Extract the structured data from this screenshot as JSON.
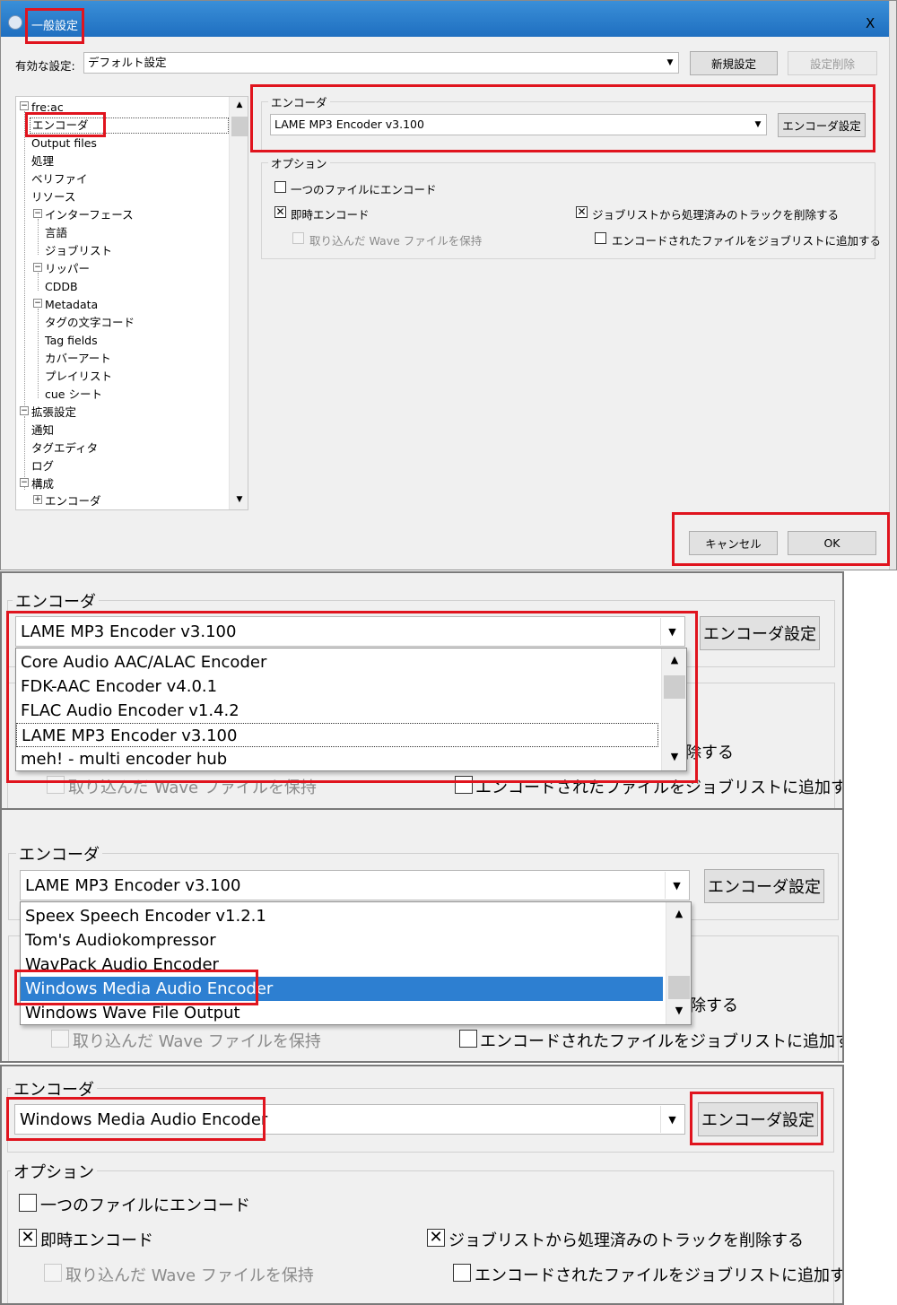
{
  "dialog": {
    "title": "一般設定",
    "close_label": "X",
    "active_setting_label": "有効な設定:",
    "active_setting_value": "デフォルト設定",
    "new_setting_button": "新規設定",
    "delete_setting_button": "設定削除",
    "cancel_button": "キャンセル",
    "ok_button": "OK"
  },
  "tree": {
    "items": [
      {
        "label": "fre:ac",
        "toggle": "−"
      },
      {
        "label": "エンコーダ"
      },
      {
        "label": "Output files"
      },
      {
        "label": "処理"
      },
      {
        "label": "ベリファイ"
      },
      {
        "label": "リソース"
      },
      {
        "label": "インターフェース",
        "toggle": "−"
      },
      {
        "label": "言語"
      },
      {
        "label": "ジョブリスト"
      },
      {
        "label": "リッパー",
        "toggle": "−"
      },
      {
        "label": "CDDB"
      },
      {
        "label": "Metadata",
        "toggle": "−"
      },
      {
        "label": "タグの文字コード"
      },
      {
        "label": "Tag fields"
      },
      {
        "label": "カバーアート"
      },
      {
        "label": "プレイリスト"
      },
      {
        "label": "cue シート"
      },
      {
        "label": "拡張設定",
        "toggle": "−"
      },
      {
        "label": "通知"
      },
      {
        "label": "タグエディタ"
      },
      {
        "label": "ログ"
      },
      {
        "label": "構成",
        "toggle": "−"
      },
      {
        "label": "エンコーダ",
        "toggle": "+"
      }
    ]
  },
  "encoder": {
    "group_label": "エンコーダ",
    "selected": "LAME MP3 Encoder v3.100",
    "settings_button": "エンコーダ設定"
  },
  "options": {
    "group_label": "オプション",
    "single_file": {
      "label": "一つのファイルにエンコード",
      "checked": false
    },
    "on_the_fly": {
      "label": "即時エンコード",
      "checked": true
    },
    "keep_wave": {
      "label": "取り込んだ Wave ファイルを保持",
      "checked": false,
      "disabled": true
    },
    "remove_processed": {
      "label": "ジョブリストから処理済みのトラックを削除する",
      "checked": true
    },
    "add_encoded": {
      "label": "エンコードされたファイルをジョブリストに追加する",
      "checked": false
    }
  },
  "zoom1": {
    "group_label": "エンコーダ",
    "selected": "LAME MP3 Encoder v3.100",
    "settings_button": "エンコーダ設定",
    "list_items": [
      "Core Audio AAC/ALAC Encoder",
      "FDK-AAC Encoder v4.0.1",
      "FLAC Audio Encoder v1.4.2",
      "LAME MP3 Encoder v3.100",
      "meh! - multi encoder hub"
    ],
    "behind_remove": "除する",
    "behind_keep_wave": "取り込んだ Wave ファイルを保持",
    "behind_add_encoded": "エンコードされたファイルをジョブリストに追加する"
  },
  "zoom2": {
    "group_label": "エンコーダ",
    "selected": "LAME MP3 Encoder v3.100",
    "settings_button": "エンコーダ設定",
    "list_items": [
      "Speex Speech Encoder v1.2.1",
      "Tom's Audiokompressor",
      "WavPack Audio Encoder",
      "Windows Media Audio Encoder",
      "Windows Wave File Output"
    ],
    "behind_remove": "除する",
    "behind_keep_wave": "取り込んだ Wave ファイルを保持",
    "behind_add_encoded": "エンコードされたファイルをジョブリストに追加する"
  },
  "zoom3": {
    "group_label": "エンコーダ",
    "selected": "Windows Media Audio Encoder",
    "settings_button": "エンコーダ設定",
    "options_label": "オプション",
    "single_file": "一つのファイルにエンコード",
    "on_the_fly": "即時エンコード",
    "keep_wave": "取り込んだ Wave ファイルを保持",
    "remove_processed": "ジョブリストから処理済みのトラックを削除する",
    "add_encoded": "エンコードされたファイルをジョブリストに追加する"
  },
  "icons": {
    "check": "✕",
    "arrow_down": "▼",
    "arrow_up": "▲"
  },
  "colors": {
    "highlight": "#e0141e",
    "selection": "#2d7fd1",
    "title_bar": "#2b7fd0"
  }
}
